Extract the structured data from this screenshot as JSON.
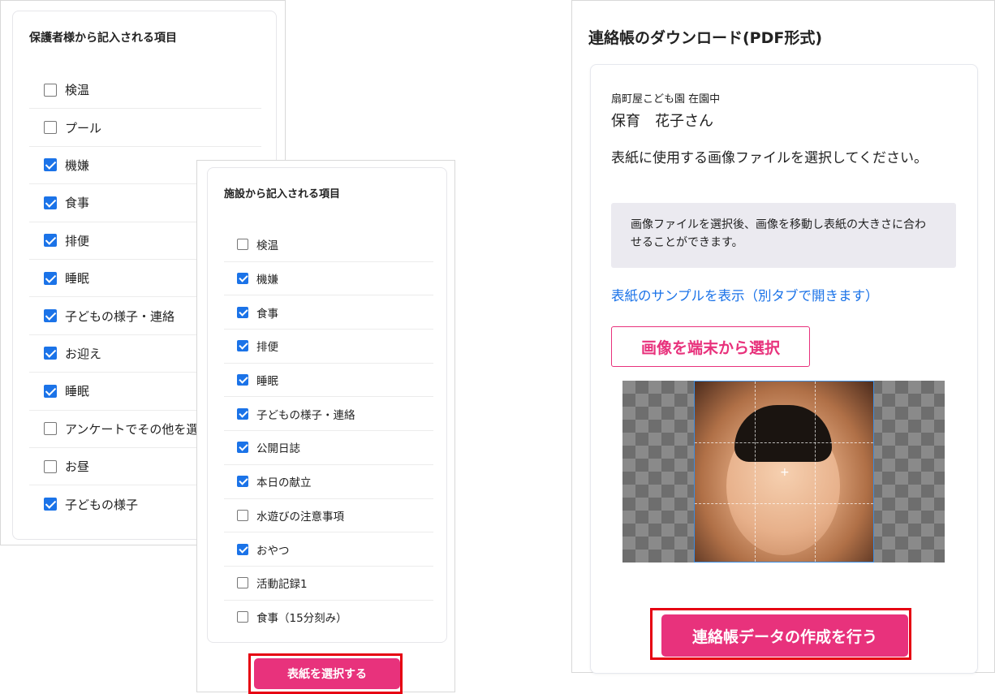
{
  "guardian_panel": {
    "title": "保護者様から記入される項目",
    "items": [
      {
        "label": "検温",
        "checked": false
      },
      {
        "label": "プール",
        "checked": false
      },
      {
        "label": "機嫌",
        "checked": true
      },
      {
        "label": "食事",
        "checked": true
      },
      {
        "label": "排便",
        "checked": true
      },
      {
        "label": "睡眠",
        "checked": true
      },
      {
        "label": "子どもの様子・連絡",
        "checked": true
      },
      {
        "label": "お迎え",
        "checked": true
      },
      {
        "label": "睡眠",
        "checked": true
      },
      {
        "label": "アンケートでその他を選ん",
        "checked": false
      },
      {
        "label": "お昼",
        "checked": false
      },
      {
        "label": "子どもの様子",
        "checked": true
      }
    ]
  },
  "facility_panel": {
    "title": "施設から記入される項目",
    "items": [
      {
        "label": "検温",
        "checked": false
      },
      {
        "label": "機嫌",
        "checked": true
      },
      {
        "label": "食事",
        "checked": true
      },
      {
        "label": "排便",
        "checked": true
      },
      {
        "label": "睡眠",
        "checked": true
      },
      {
        "label": "子どもの様子・連絡",
        "checked": true
      },
      {
        "label": "公開日誌",
        "checked": true
      },
      {
        "label": "本日の献立",
        "checked": true
      },
      {
        "label": "水遊びの注意事項",
        "checked": false
      },
      {
        "label": "おやつ",
        "checked": true
      },
      {
        "label": "活動記録1",
        "checked": false
      },
      {
        "label": "食事（15分刻み）",
        "checked": false
      }
    ],
    "select_cover_button": "表紙を選択する"
  },
  "download_panel": {
    "title": "連絡帳のダウンロード(PDF形式)",
    "school_status": "扇町屋こども園 在園中",
    "child_name": "保育　花子さん",
    "instruction": "表紙に使用する画像ファイルを選択してください。",
    "note": "画像ファイルを選択後、画像を移動し表紙の大きさに合わせることができます。",
    "sample_link": "表紙のサンプルを表示（別タブで開きます）",
    "pick_image_button": "画像を端末から選択",
    "create_button": "連絡帳データの作成を行う"
  },
  "colors": {
    "accent_pink": "#e8327c",
    "checkbox_blue": "#1b73e8",
    "highlight_red": "#e60012",
    "link_blue": "#1b73e8"
  }
}
